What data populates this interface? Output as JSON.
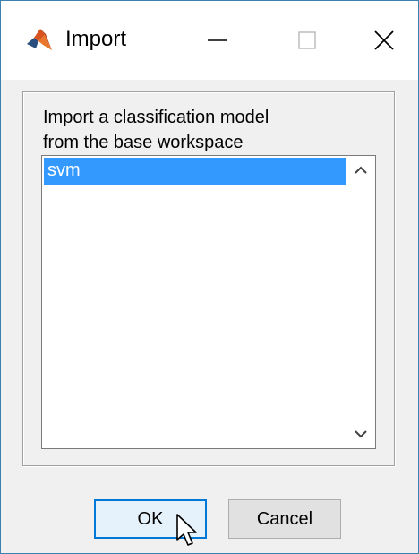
{
  "window": {
    "title": "Import",
    "icon": "matlab-logo-icon",
    "controls": [
      "minimize-icon",
      "maximize-icon",
      "close-icon"
    ]
  },
  "panel": {
    "instruction_line1": "Import a classification model",
    "instruction_line2": "from the base workspace"
  },
  "listbox": {
    "items": [
      {
        "label": "svm",
        "selected": true
      }
    ]
  },
  "buttons": {
    "ok_label": "OK",
    "cancel_label": "Cancel"
  },
  "colors": {
    "selection": "#3399ff",
    "focus_border": "#0078d7",
    "window_border": "#3c7fb1"
  }
}
